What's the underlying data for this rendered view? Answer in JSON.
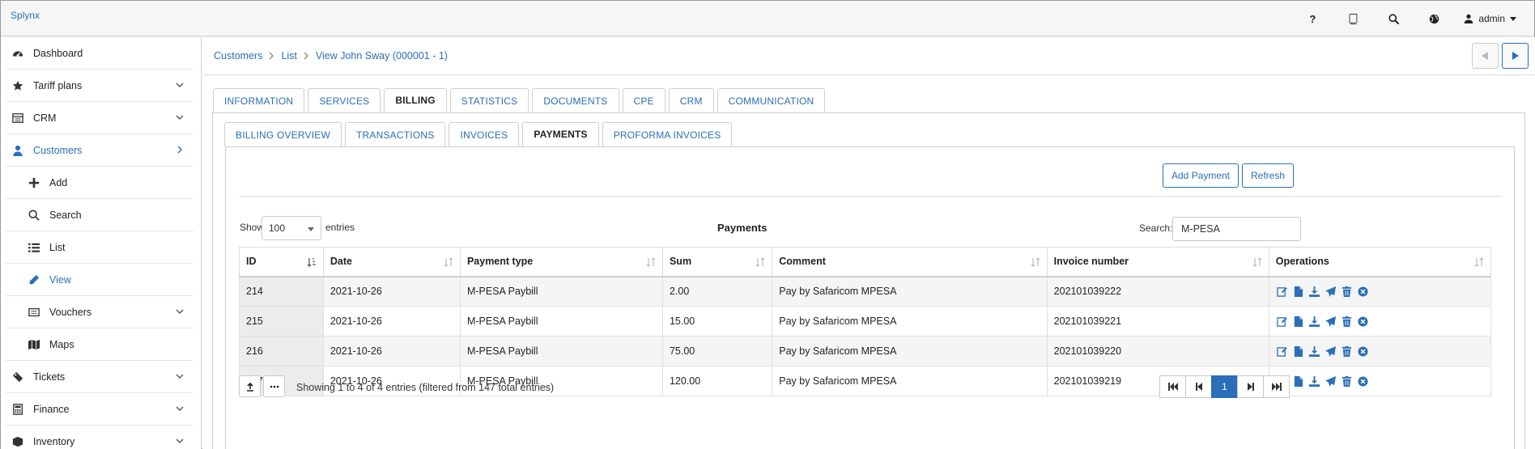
{
  "app": {
    "brand": "Splynx"
  },
  "topbar": {
    "icons": [
      "help-icon",
      "book-icon",
      "search-icon",
      "globe-icon"
    ],
    "help_label": "?",
    "user_label": "admin"
  },
  "sidebar": {
    "items": [
      {
        "label": "Dashboard",
        "icon": "dashboard-icon",
        "expandable": false
      },
      {
        "label": "Tariff plans",
        "icon": "star-icon",
        "expandable": true
      },
      {
        "label": "CRM",
        "icon": "crm-icon",
        "expandable": true
      },
      {
        "label": "Customers",
        "icon": "user-icon",
        "expandable": true,
        "active": true
      },
      {
        "label": "Add",
        "icon": "plus-icon",
        "sub": true
      },
      {
        "label": "Search",
        "icon": "search-icon",
        "sub": true
      },
      {
        "label": "List",
        "icon": "list-icon",
        "sub": true
      },
      {
        "label": "View",
        "icon": "pencil-icon",
        "sub": true,
        "active": true
      },
      {
        "label": "Vouchers",
        "icon": "voucher-icon",
        "sub": true,
        "expandable": true
      },
      {
        "label": "Maps",
        "icon": "map-icon",
        "sub": true
      },
      {
        "label": "Tickets",
        "icon": "ticket-icon",
        "expandable": true
      },
      {
        "label": "Finance",
        "icon": "calculator-icon",
        "expandable": true
      },
      {
        "label": "Inventory",
        "icon": "box-icon",
        "expandable": true
      }
    ]
  },
  "breadcrumb": [
    "Customers",
    "List",
    "View John Sway (000001 - 1)"
  ],
  "main_tabs": [
    "INFORMATION",
    "SERVICES",
    "BILLING",
    "STATISTICS",
    "DOCUMENTS",
    "CPE",
    "CRM",
    "COMMUNICATION"
  ],
  "main_tab_active": "BILLING",
  "sub_tabs": [
    "BILLING OVERVIEW",
    "TRANSACTIONS",
    "INVOICES",
    "PAYMENTS",
    "PROFORMA INVOICES"
  ],
  "sub_tab_active": "PAYMENTS",
  "actions": {
    "add_payment": "Add Payment",
    "refresh": "Refresh"
  },
  "table_controls": {
    "show_label": "Show",
    "page_size": "100",
    "entries_label": "entries",
    "title": "Payments",
    "search_label": "Search:",
    "search_value": "M-PESA"
  },
  "table": {
    "columns": [
      "ID",
      "Date",
      "Payment type",
      "Sum",
      "Comment",
      "Invoice number",
      "Operations"
    ],
    "rows": [
      {
        "id": "214",
        "date": "2021-10-26",
        "type": "M-PESA Paybill",
        "sum": "2.00",
        "comment": "Pay by Safaricom MPESA",
        "invoice": "202101039222"
      },
      {
        "id": "215",
        "date": "2021-10-26",
        "type": "M-PESA Paybill",
        "sum": "15.00",
        "comment": "Pay by Safaricom MPESA",
        "invoice": "202101039221"
      },
      {
        "id": "216",
        "date": "2021-10-26",
        "type": "M-PESA Paybill",
        "sum": "75.00",
        "comment": "Pay by Safaricom MPESA",
        "invoice": "202101039220"
      },
      {
        "id": "217",
        "date": "2021-10-26",
        "type": "M-PESA Paybill",
        "sum": "120.00",
        "comment": "Pay by Safaricom MPESA",
        "invoice": "202101039219"
      }
    ],
    "row_operations": [
      "edit-icon",
      "document-icon",
      "download-icon",
      "send-icon",
      "delete-icon",
      "cancel-icon"
    ]
  },
  "footer": {
    "info": "Showing 1 to 4 of 4 entries (filtered from 147 total entries)",
    "current_page": "1"
  },
  "colors": {
    "accent": "#2a6fb8"
  }
}
